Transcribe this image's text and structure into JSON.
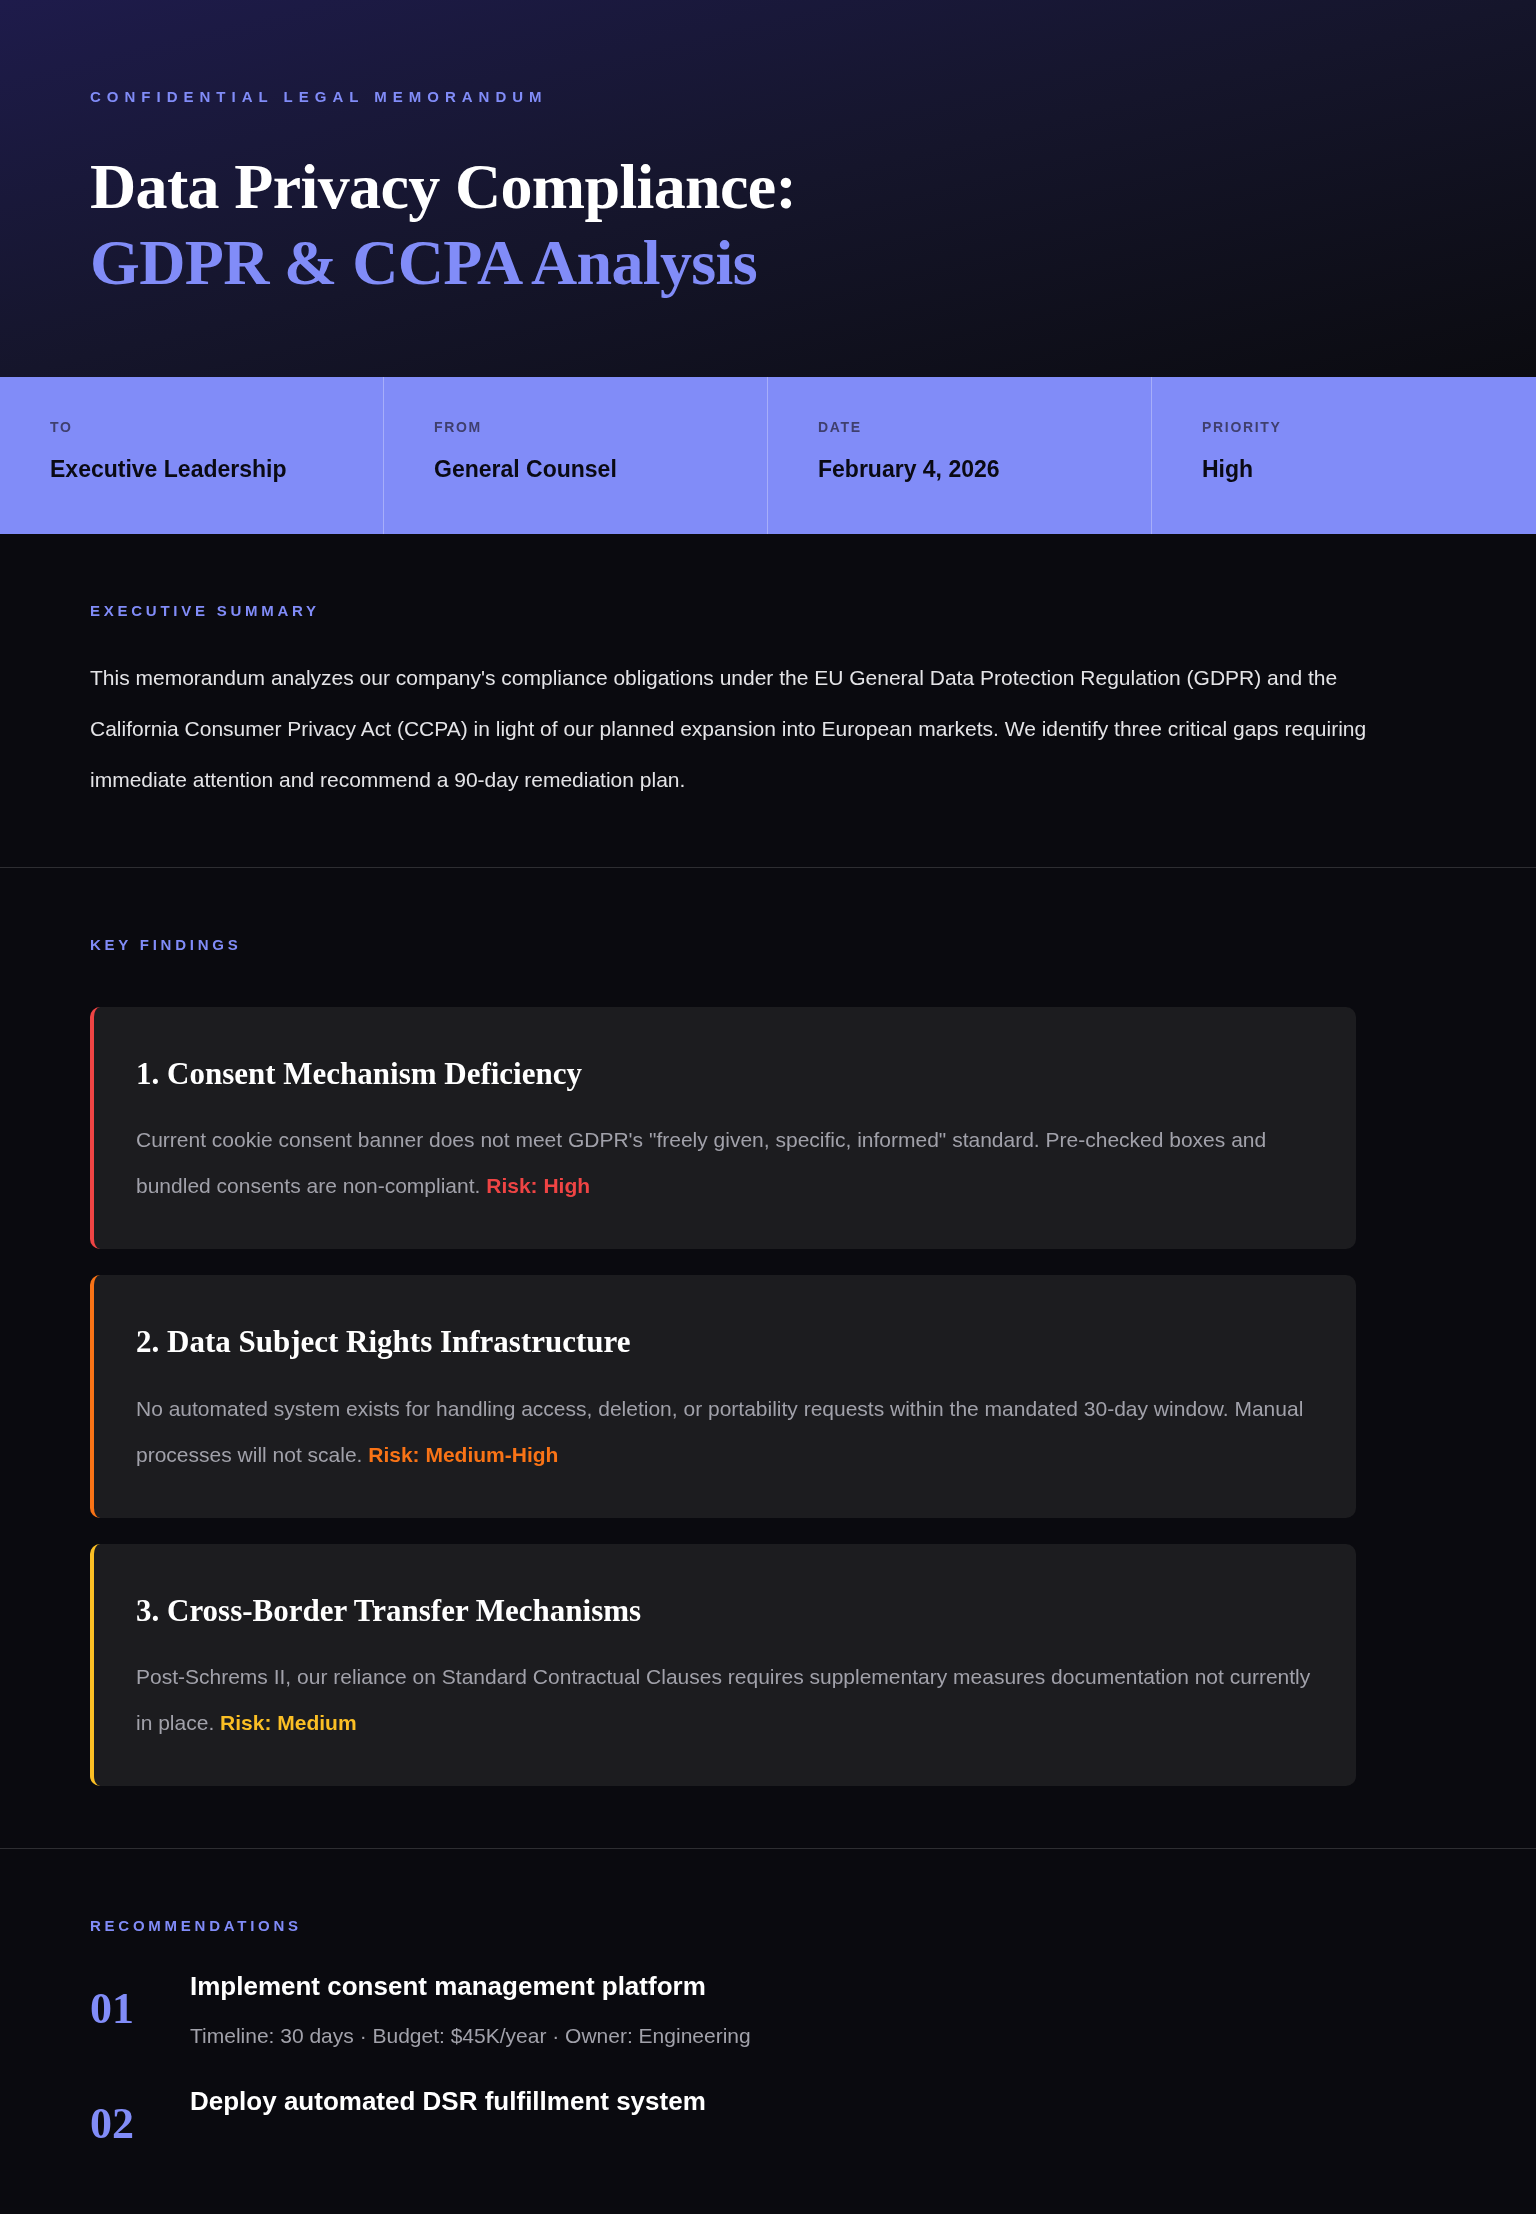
{
  "header": {
    "eyebrow": "CONFIDENTIAL LEGAL MEMORANDUM",
    "title_line_1": "Data Privacy Compliance:",
    "title_line_2": "GDPR & CCPA Analysis"
  },
  "meta": [
    {
      "label": "TO",
      "value": "Executive Leadership"
    },
    {
      "label": "FROM",
      "value": "General Counsel"
    },
    {
      "label": "DATE",
      "value": "February 4, 2026"
    },
    {
      "label": "PRIORITY",
      "value": "High"
    }
  ],
  "executive_summary": {
    "heading": "EXECUTIVE SUMMARY",
    "text": "This memorandum analyzes our company's compliance obligations under the EU General Data Protection Regulation (GDPR) and the California Consumer Privacy Act (CCPA) in light of our planned expansion into European markets. We identify three critical gaps requiring immediate attention and recommend a 90-day remediation plan."
  },
  "key_findings": {
    "heading": "KEY FINDINGS",
    "items": [
      {
        "title": "1. Consent Mechanism Deficiency",
        "text": "Current cookie consent banner does not meet GDPR's \"freely given, specific, informed\" standard. Pre-checked boxes and bundled consents are non-compliant.",
        "risk": "Risk: High",
        "color": "#ef4444"
      },
      {
        "title": "2. Data Subject Rights Infrastructure",
        "text": "No automated system exists for handling access, deletion, or portability requests within the mandated 30-day window. Manual processes will not scale.",
        "risk": "Risk: Medium-High",
        "color": "#f97316"
      },
      {
        "title": "3. Cross-Border Transfer Mechanisms",
        "text": "Post-Schrems II, our reliance on Standard Contractual Clauses requires supplementary measures documentation not currently in place.",
        "risk": "Risk: Medium",
        "color": "#fbbf24"
      }
    ]
  },
  "recommendations": {
    "heading": "RECOMMENDATIONS",
    "items": [
      {
        "number": "01",
        "title": "Implement consent management platform",
        "details": "Timeline: 30 days · Budget: $45K/year · Owner: Engineering"
      },
      {
        "number": "02",
        "title": "Deploy automated DSR fulfillment system"
      }
    ]
  }
}
